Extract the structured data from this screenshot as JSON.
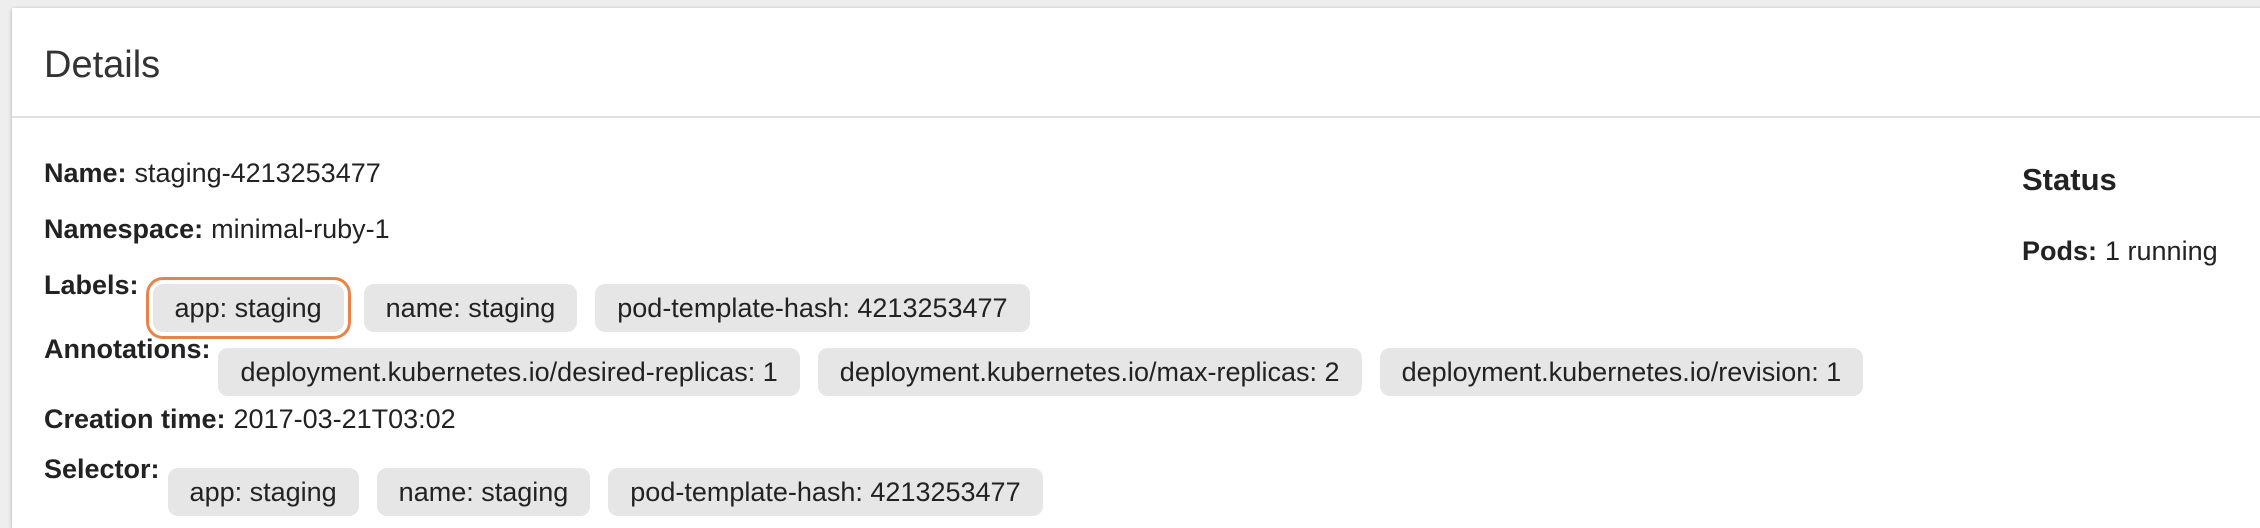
{
  "header": {
    "title": "Details"
  },
  "details": {
    "name": {
      "label": "Name:",
      "value": "staging-4213253477"
    },
    "namespace": {
      "label": "Namespace:",
      "value": "minimal-ruby-1"
    },
    "labels": {
      "label": "Labels:",
      "chips": [
        "app: staging",
        "name: staging",
        "pod-template-hash: 4213253477"
      ]
    },
    "annotations": {
      "label": "Annotations:",
      "chips": [
        "deployment.kubernetes.io/desired-replicas: 1",
        "deployment.kubernetes.io/max-replicas: 2",
        "deployment.kubernetes.io/revision: 1"
      ]
    },
    "creation_time": {
      "label": "Creation time:",
      "value": "2017-03-21T03:02"
    },
    "selector": {
      "label": "Selector:",
      "chips": [
        "app: staging",
        "name: staging",
        "pod-template-hash: 4213253477"
      ]
    }
  },
  "status": {
    "title": "Status",
    "pods": {
      "label": "Pods:",
      "value": "1 running"
    }
  },
  "colors": {
    "highlight": "#e8834a",
    "chip_background": "#e6e6e6"
  }
}
